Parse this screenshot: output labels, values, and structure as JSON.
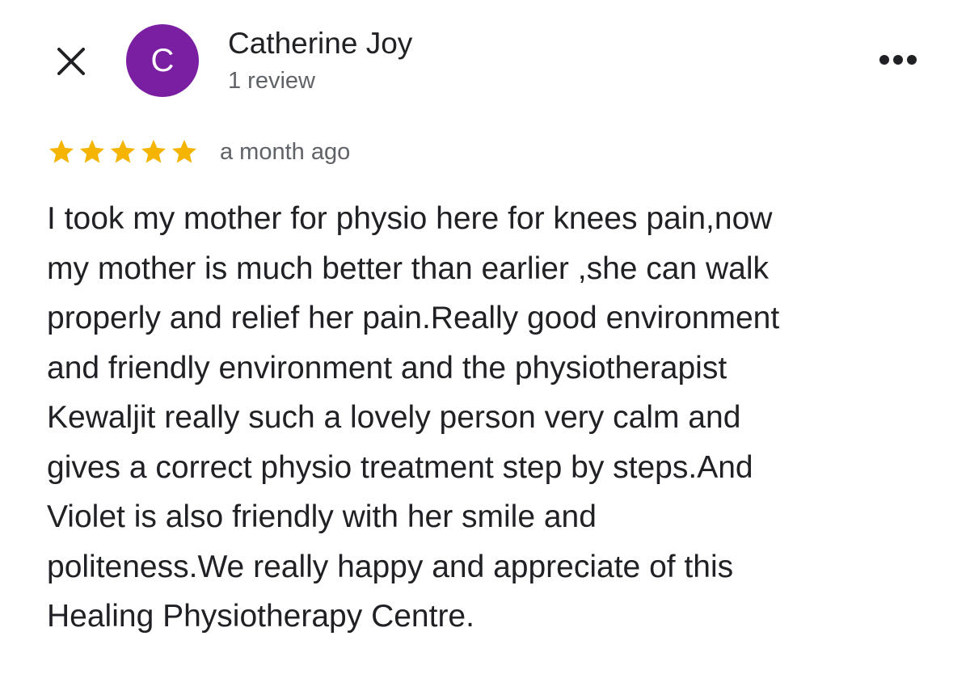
{
  "reviewer": {
    "initial": "C",
    "name": "Catherine Joy",
    "review_count": "1 review",
    "avatar_color": "#7b1fa2"
  },
  "icons": {
    "close": "close-icon",
    "more": "more-options-icon",
    "star": "star-icon"
  },
  "review": {
    "rating": 5,
    "max_rating": 5,
    "star_color": "#f4b400",
    "time": "a month ago",
    "lines": [
      "I took my mother for physio here for knees pain,now",
      "my mother is much better than earlier ,she can walk",
      "properly and relief her pain.Really good environment",
      "and friendly environment and the physiotherapist",
      "Kewaljit really such a lovely person very calm and",
      "gives a correct physio treatment step by steps.And",
      "Violet is also friendly with her smile and",
      "politeness.We really happy and appreciate of this",
      "Healing Physiotherapy Centre."
    ]
  }
}
